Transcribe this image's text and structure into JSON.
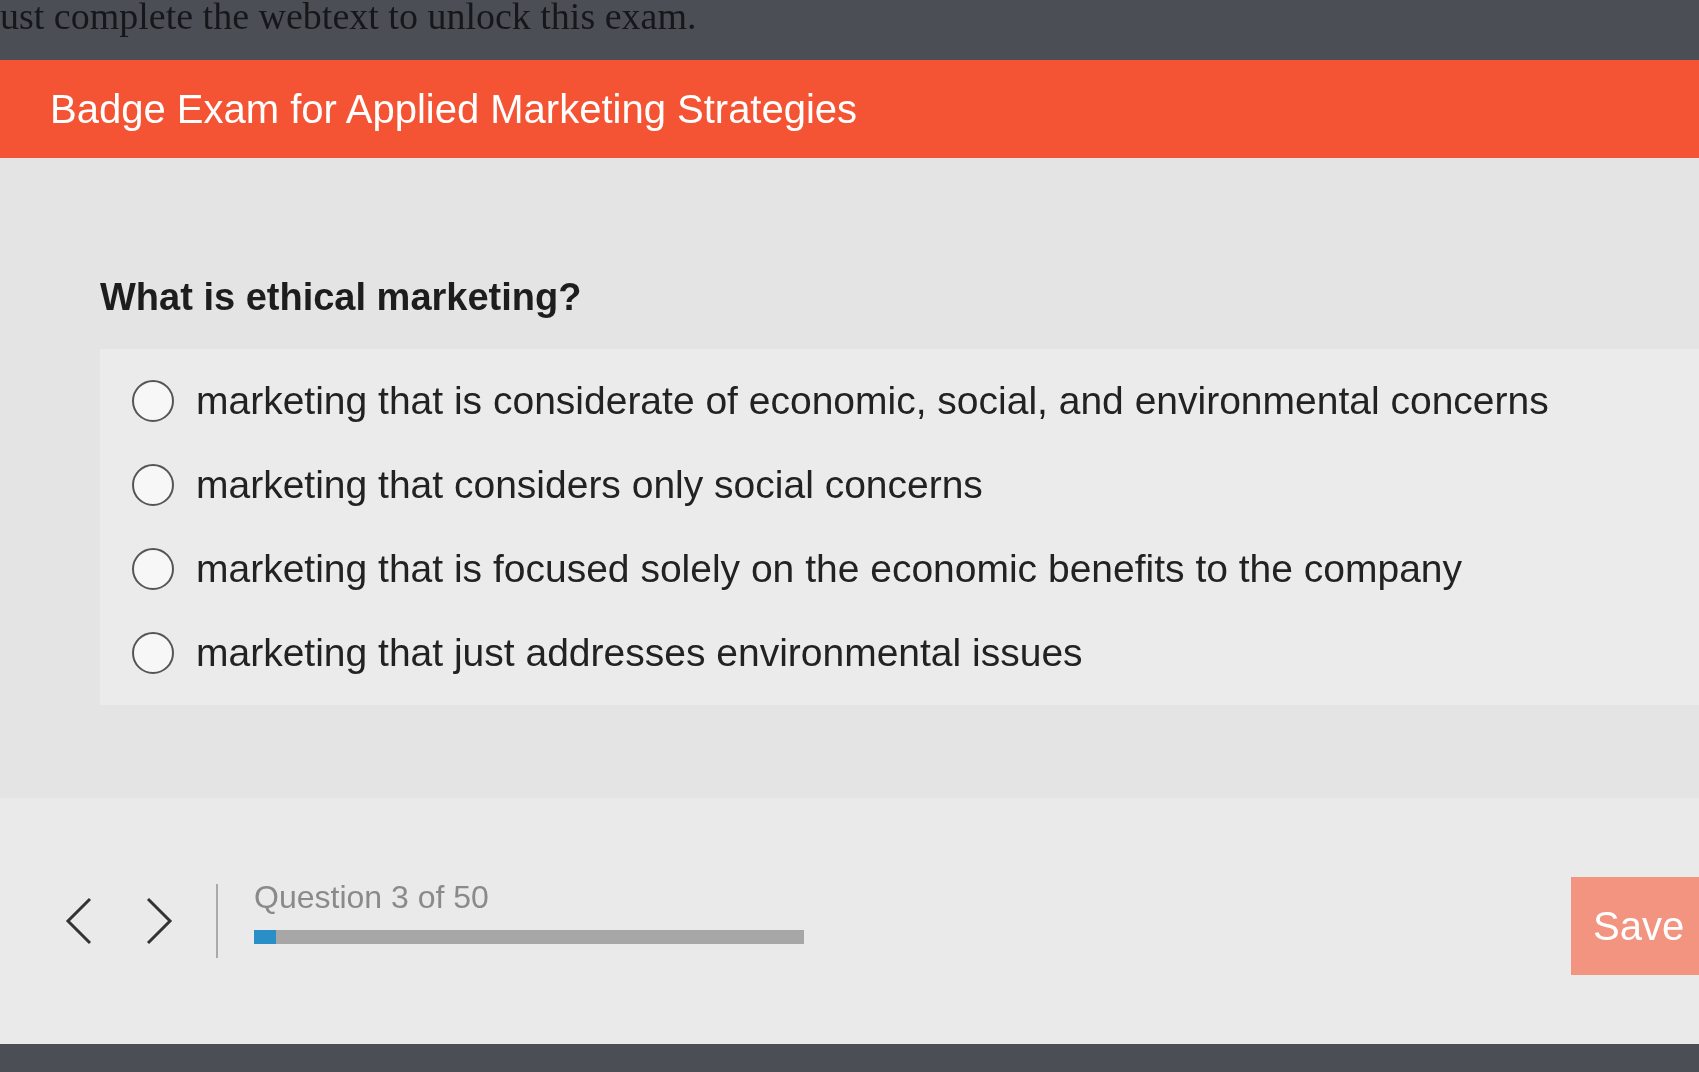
{
  "notice": "ust complete the webtext to unlock this exam.",
  "header": {
    "title": "Badge Exam for Applied Marketing Strategies"
  },
  "question": "What is ethical marketing?",
  "options": [
    {
      "label": "marketing that is considerate of economic, social, and environmental concerns",
      "selected": false
    },
    {
      "label": "marketing that considers only social concerns",
      "selected": false
    },
    {
      "label": "marketing that is focused solely on the economic benefits to the company",
      "selected": false
    },
    {
      "label": "marketing that just addresses environmental issues",
      "selected": false
    }
  ],
  "footer": {
    "progress_text": "Question 3 of 50",
    "progress": {
      "level": 0.04
    },
    "save_button": "Save"
  }
}
